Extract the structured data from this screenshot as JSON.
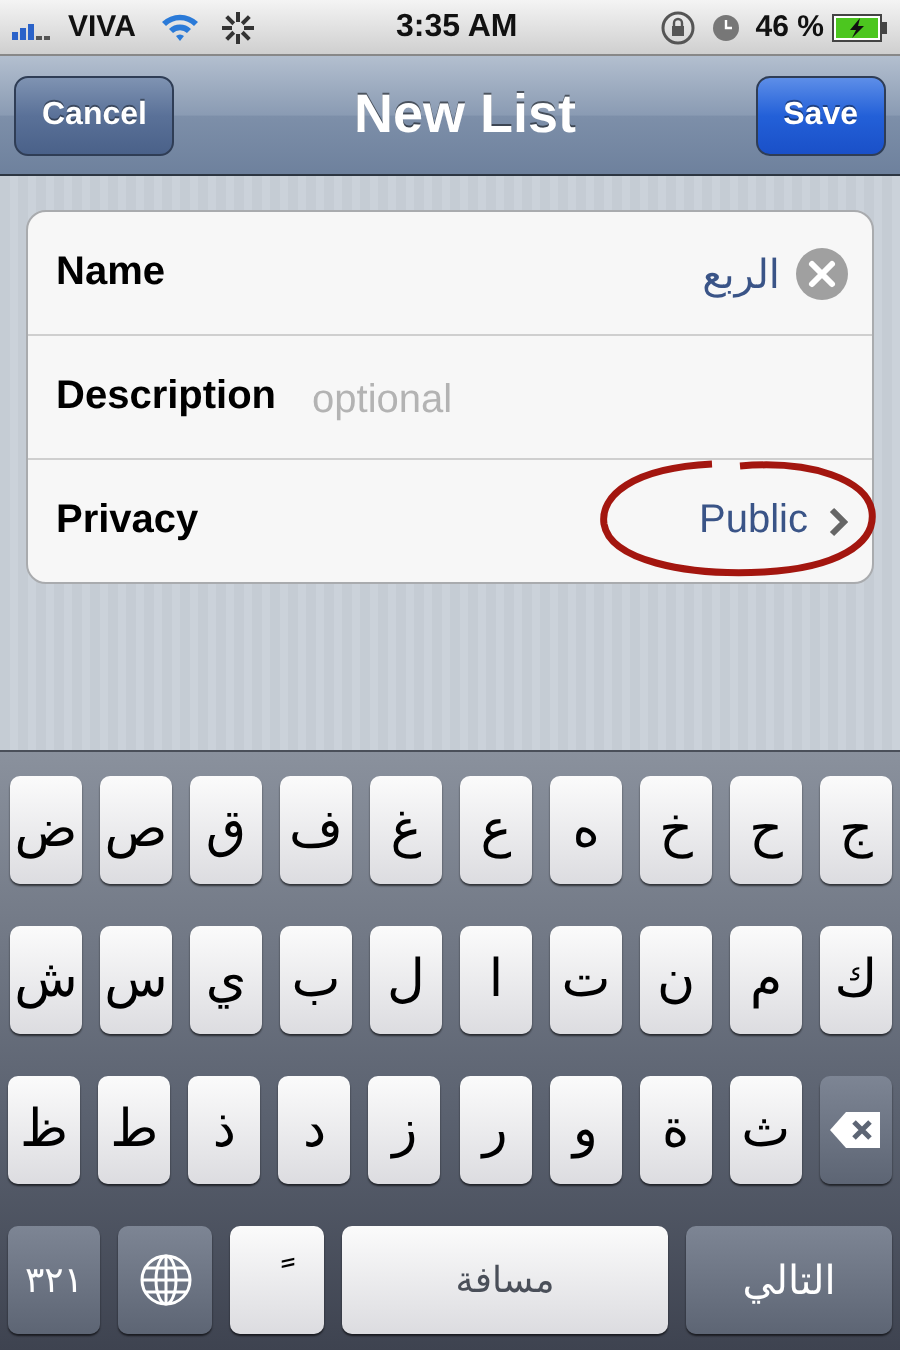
{
  "status_bar": {
    "carrier": "VIVA",
    "time": "3:35 AM",
    "battery": "46 %"
  },
  "nav_bar": {
    "left_button": "Cancel",
    "title": "New List",
    "right_button": "Save"
  },
  "form": [
    {
      "kind": "text",
      "label": "Name",
      "value": "الربع",
      "clearable": true
    },
    {
      "kind": "text",
      "label": "Description",
      "placeholder": "optional"
    },
    {
      "kind": "disclosure",
      "label": "Privacy",
      "value": "Public",
      "circled": true
    }
  ],
  "keyboard": {
    "rows": [
      [
        "ض",
        "ص",
        "ق",
        "ف",
        "غ",
        "ع",
        "ه",
        "خ",
        "ح",
        "ج"
      ],
      [
        "ش",
        "س",
        "ي",
        "ب",
        "ل",
        "ا",
        "ت",
        "ن",
        "م",
        "ك"
      ],
      [
        "ظ",
        "ط",
        "ذ",
        "د",
        "ز",
        "ر",
        "و",
        "ة",
        "ث"
      ]
    ],
    "mode_key": "٣٢١",
    "diacritic_key": "ً",
    "space_key": "مسافة",
    "return_key": "التالي"
  }
}
